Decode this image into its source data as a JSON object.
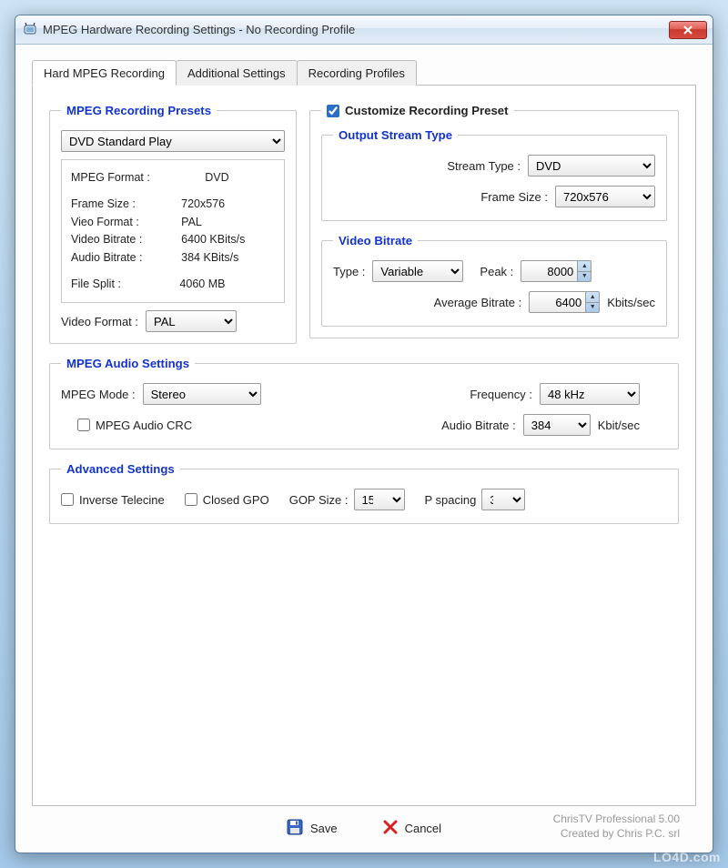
{
  "window": {
    "title": "MPEG Hardware Recording Settings - No Recording Profile"
  },
  "tabs": {
    "t1": "Hard MPEG Recording",
    "t2": "Additional Settings",
    "t3": "Recording Profiles"
  },
  "presets": {
    "legend": "MPEG Recording Presets",
    "preset_select": "DVD Standard Play",
    "info": {
      "mpeg_format_lbl": "MPEG Format :",
      "mpeg_format_val": "DVD",
      "frame_size_lbl": "Frame Size :",
      "frame_size_val": "720x576",
      "video_format_lbl": "Vieo Format :",
      "video_format_val": "PAL",
      "video_bitrate_lbl": "Video Bitrate :",
      "video_bitrate_val": "6400 KBits/s",
      "audio_bitrate_lbl": "Audio Bitrate :",
      "audio_bitrate_val": "384 KBits/s",
      "file_split_lbl": "File Split :",
      "file_split_val": "4060 MB"
    },
    "video_format_lbl": "Video Format :",
    "video_format_select": "PAL"
  },
  "customize": {
    "legend": "Customize Recording Preset",
    "output": {
      "legend": "Output Stream Type",
      "stream_type_lbl": "Stream Type :",
      "stream_type_val": "DVD",
      "frame_size_lbl": "Frame Size :",
      "frame_size_val": "720x576"
    },
    "bitrate": {
      "legend": "Video Bitrate",
      "type_lbl": "Type :",
      "type_val": "Variable",
      "peak_lbl": "Peak :",
      "peak_val": "8000",
      "avg_lbl": "Average Bitrate :",
      "avg_val": "6400",
      "avg_unit": "Kbits/sec"
    }
  },
  "audio": {
    "legend": "MPEG Audio Settings",
    "mode_lbl": "MPEG Mode :",
    "mode_val": "Stereo",
    "freq_lbl": "Frequency :",
    "freq_val": "48 kHz",
    "crc_lbl": "MPEG Audio CRC",
    "bitrate_lbl": "Audio Bitrate :",
    "bitrate_val": "384",
    "bitrate_unit": "Kbit/sec"
  },
  "advanced": {
    "legend": "Advanced Settings",
    "inverse_lbl": "Inverse Telecine",
    "closed_lbl": "Closed GPO",
    "gop_lbl": "GOP Size :",
    "gop_val": "15",
    "pspace_lbl": "P spacing",
    "pspace_val": "3"
  },
  "footer": {
    "save": "Save",
    "cancel": "Cancel",
    "credit1": "ChrisTV Professional 5.00",
    "credit2": "Created by Chris P.C. srl"
  },
  "watermark": "LO4D.com"
}
